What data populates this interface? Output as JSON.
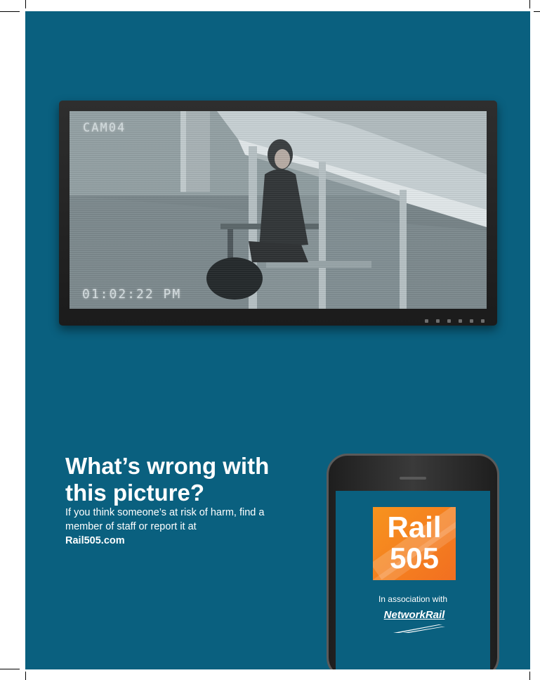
{
  "colors": {
    "poster_background": "#0a607f",
    "logo_orange": "#f26f21",
    "text": "#ffffff"
  },
  "cctv": {
    "camera_label": "CAM04",
    "timestamp": "01:02:22 PM"
  },
  "headline": {
    "line1": "What’s wrong with",
    "line2": "this picture?"
  },
  "body": {
    "text": "If you think someone’s at risk of harm, find a member of staff or report it at",
    "link": "Rail505.com"
  },
  "phone": {
    "logo_line1": "Rail",
    "logo_line2": "505",
    "association": "In association with",
    "partner_logo": "NetworkRail"
  }
}
